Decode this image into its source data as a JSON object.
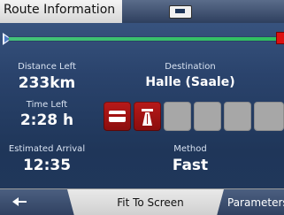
{
  "window": {
    "title": "Route Information"
  },
  "summary": {
    "distance_left_label": "Distance Left",
    "distance_left_value": "233km",
    "time_left_label": "Time Left",
    "time_left_value": "2:28 h",
    "eta_label": "Estimated Arrival",
    "eta_value": "12:35",
    "destination_label": "Destination",
    "destination_value": "Halle (Saale)",
    "method_label": "Method",
    "method_value": "Fast"
  },
  "route_types": [
    {
      "icon": "toll-card-icon",
      "active": true
    },
    {
      "icon": "motorway-icon",
      "active": true
    },
    {
      "icon": "empty-slot",
      "active": false
    },
    {
      "icon": "empty-slot",
      "active": false
    },
    {
      "icon": "empty-slot",
      "active": false
    },
    {
      "icon": "empty-slot",
      "active": false
    }
  ],
  "bottom_bar": {
    "fit_to_screen_label": "Fit To Screen",
    "parameters_label": "Parameters"
  },
  "icons": {
    "top_icon": "battery-icon",
    "back_icon": "back-arrow-icon",
    "start_flag": "route-start-flag-icon",
    "destination_flag": "route-destination-flag-icon"
  },
  "colors": {
    "background_top": "#3d5a86",
    "background_bottom": "#20385c",
    "route_line": "#2fbf5f",
    "active_tile": "#b81a1a",
    "inactive_tile": "#a7a7a7"
  }
}
